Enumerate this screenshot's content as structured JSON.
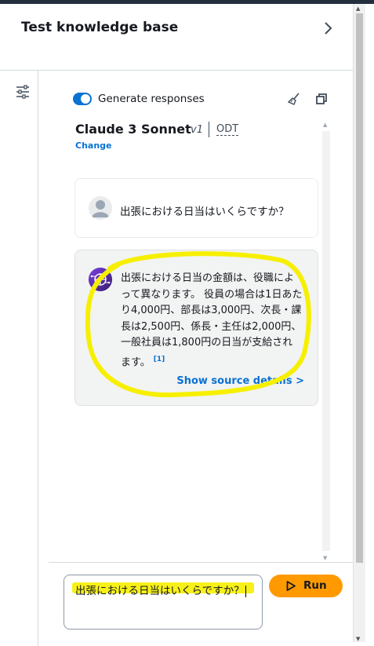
{
  "panel": {
    "title": "Test knowledge base"
  },
  "settings": {
    "generate_responses_label": "Generate responses",
    "generate_responses_on": true
  },
  "model": {
    "name": "Claude 3 Sonnet",
    "version": "v1",
    "tag": "ODT",
    "change_label": "Change"
  },
  "messages": {
    "user": {
      "text": "出張における日当はいくらですか？"
    },
    "assistant": {
      "text": "出張における日当の金額は、役職によって異なります。 役員の場合は1日あたり4,000円、部長は3,000円、次長・課長は2,500円、係長・主任は2,000円、一般社員は1,800円の日当が支給されます。",
      "citation": "[1]",
      "show_source_label": "Show source details >"
    }
  },
  "input": {
    "value": "出張における日当はいくらですか？"
  },
  "run_button": {
    "label": "Run"
  },
  "icons": {
    "expand": "chevron-right-icon",
    "settings": "sliders-icon",
    "clear": "broom-icon",
    "copy": "copy-icon",
    "user": "user-avatar-icon",
    "assistant": "brain-icon",
    "run": "play-icon"
  },
  "colors": {
    "accent": "#0972d3",
    "run": "#ff9900",
    "annotation": "#f6f000"
  }
}
